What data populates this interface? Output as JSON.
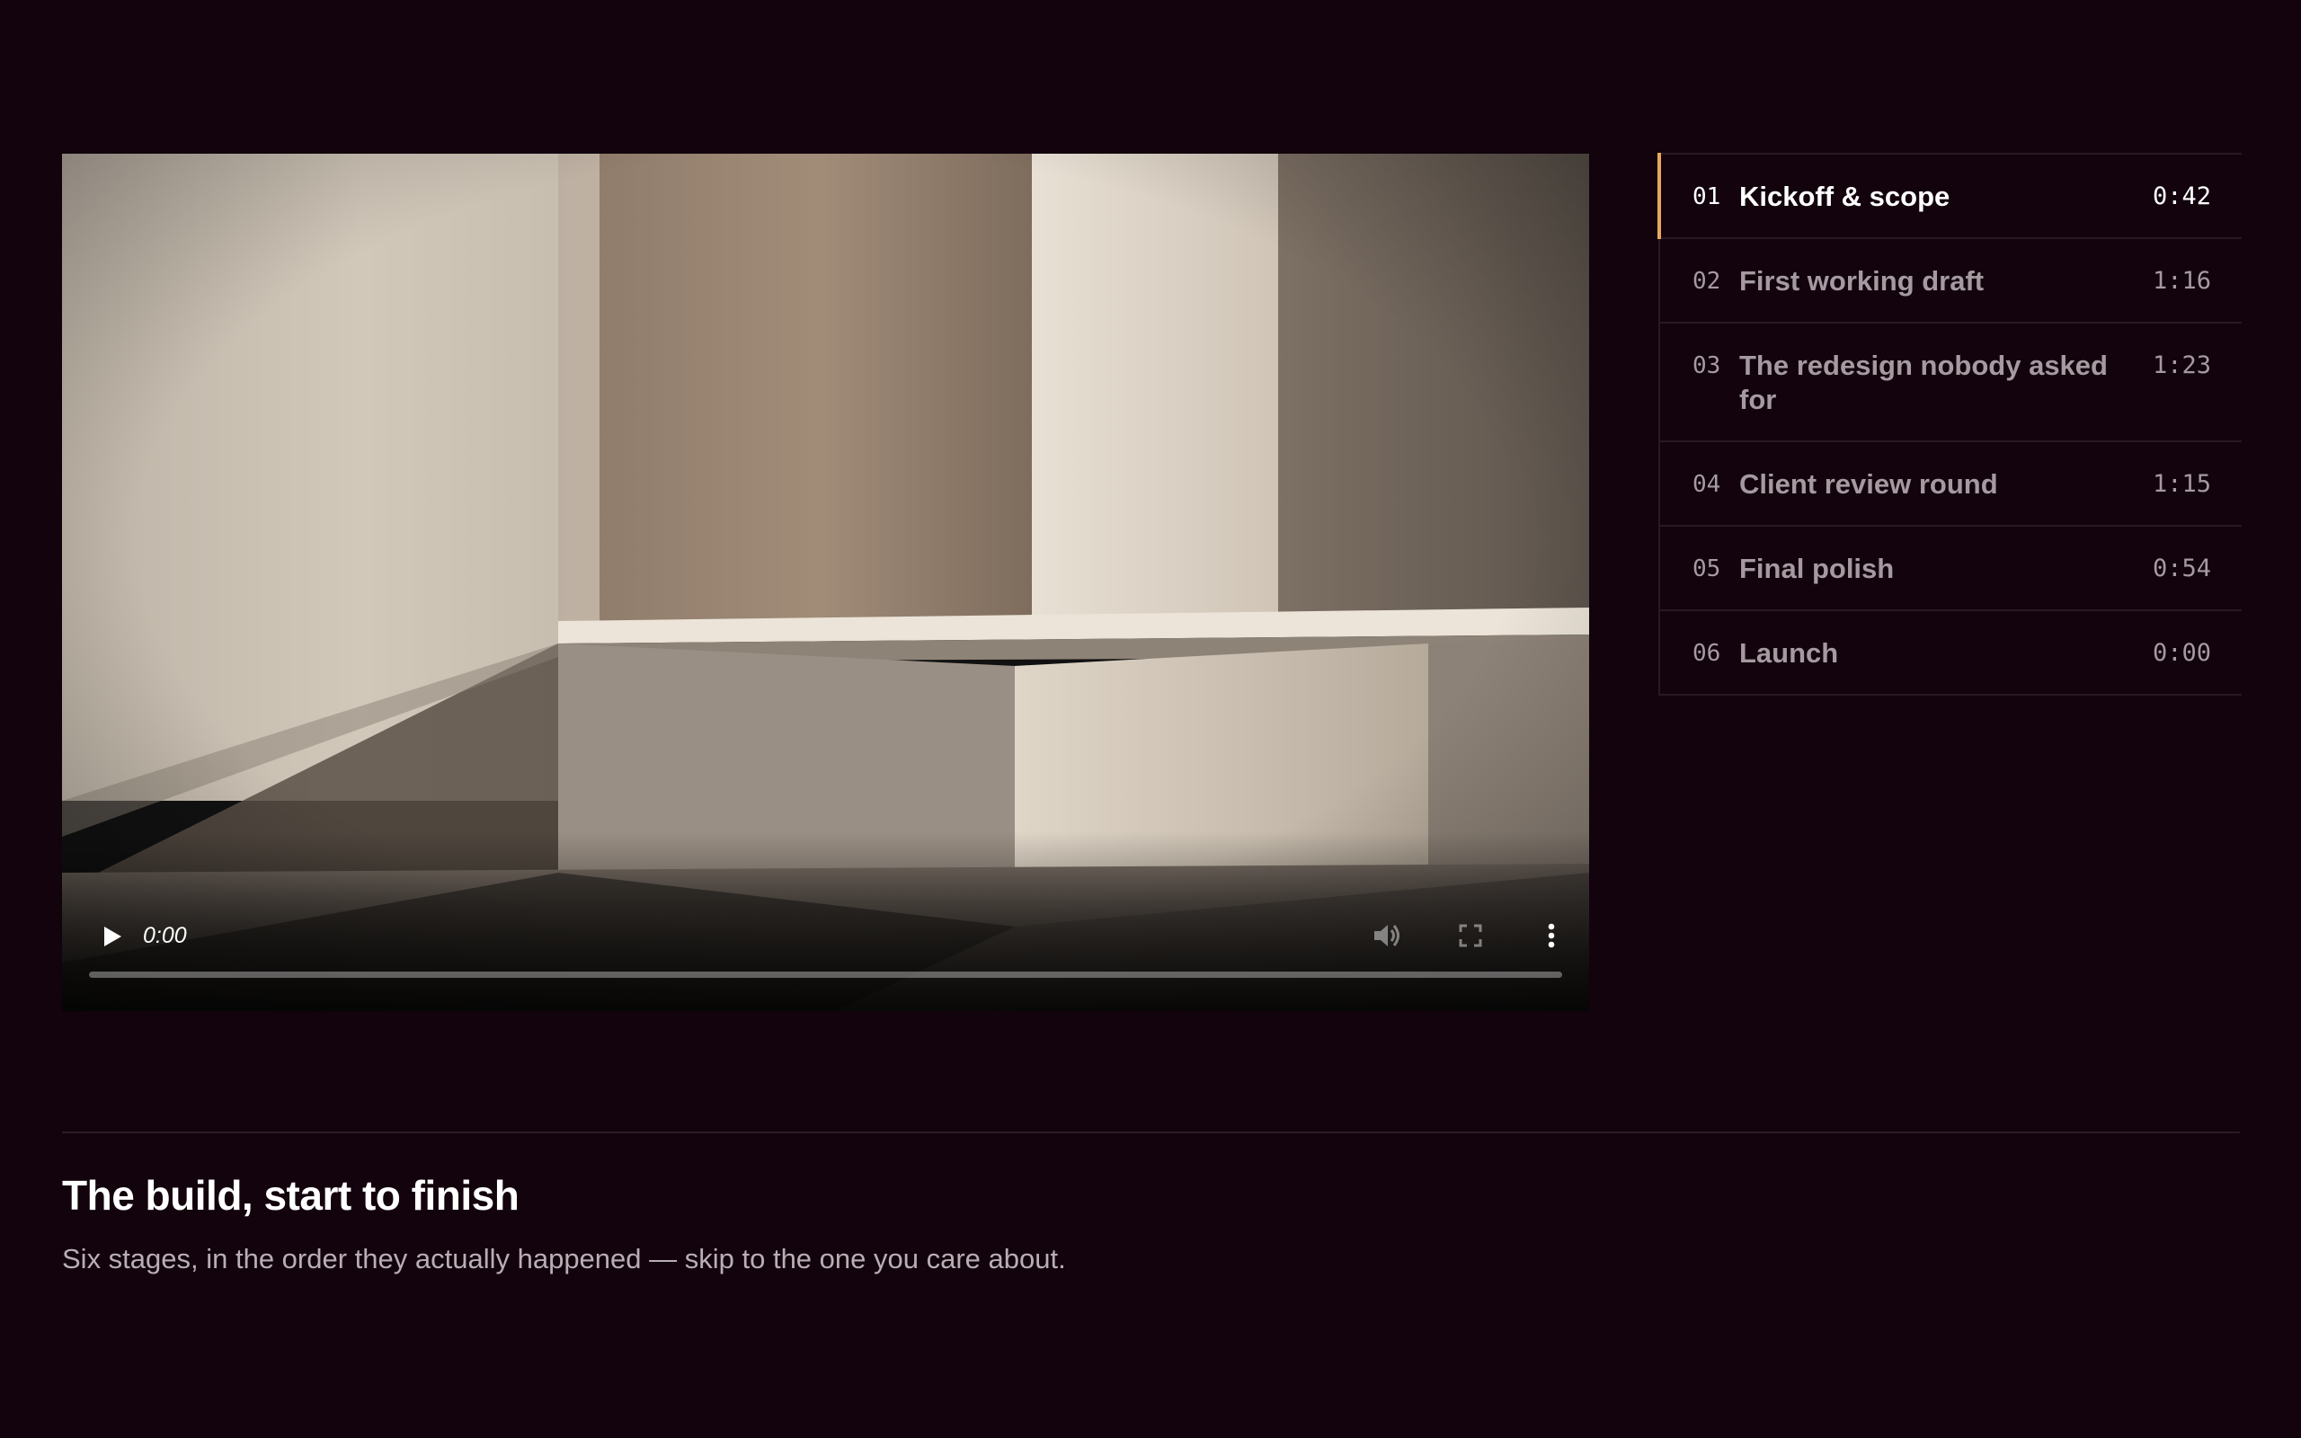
{
  "video": {
    "current_time": "0:00",
    "progress": 0,
    "icons": {
      "play": "play-icon",
      "volume": "volume-icon",
      "fullscreen": "fullscreen-icon",
      "more": "more-vertical-icon"
    }
  },
  "chapters": [
    {
      "number": "01",
      "title": "Kickoff & scope",
      "duration": "0:42",
      "active": true
    },
    {
      "number": "02",
      "title": "First working draft",
      "duration": "1:16",
      "active": false
    },
    {
      "number": "03",
      "title": "The redesign nobody asked for",
      "duration": "1:23",
      "active": false
    },
    {
      "number": "04",
      "title": "Client review round",
      "duration": "1:15",
      "active": false
    },
    {
      "number": "05",
      "title": "Final polish",
      "duration": "0:54",
      "active": false
    },
    {
      "number": "06",
      "title": "Launch",
      "duration": "0:00",
      "active": false
    }
  ],
  "caption": {
    "title": "The build, start to finish",
    "subtitle": "Six stages, in the order they actually happened — skip to the one you care about."
  },
  "colors": {
    "background": "#12030d",
    "accent": "#e8a85a",
    "active_text": "#ffffff",
    "inactive_text": "#a59aa0"
  }
}
